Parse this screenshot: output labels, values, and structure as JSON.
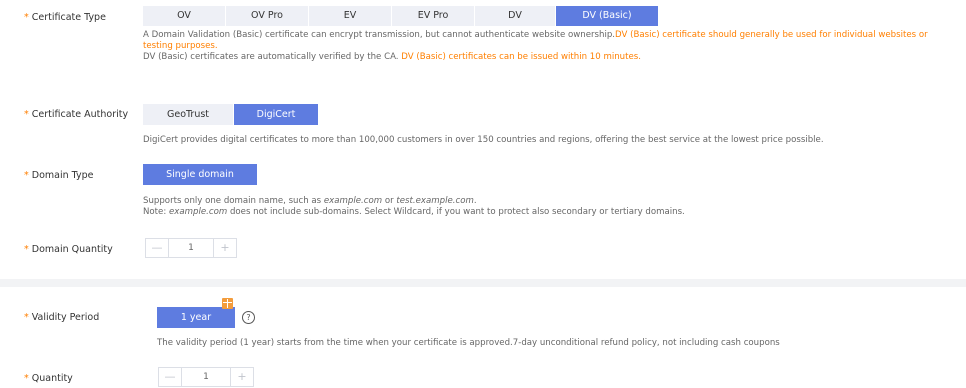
{
  "certificate_type": {
    "label": "Certificate Type",
    "options": [
      "OV",
      "OV Pro",
      "EV",
      "EV Pro",
      "DV",
      "DV (Basic)"
    ],
    "selected": "DV (Basic)",
    "desc_line1_a": "A Domain Validation (Basic) certificate can encrypt transmission, but cannot authenticate website ownership.",
    "desc_line1_b": "DV (Basic) certificate should generally be used for individual websites or",
    "desc_line2": "testing purposes.",
    "desc_line3_a": "DV (Basic) certificates are automatically verified by the CA. ",
    "desc_line3_b": "DV (Basic) certificates can be issued within 10 minutes."
  },
  "certificate_authority": {
    "label": "Certificate Authority",
    "options": [
      "GeoTrust",
      "DigiCert"
    ],
    "selected": "DigiCert",
    "desc": "DigiCert provides digital certificates to more than 100,000 customers in over 150 countries and regions, offering the best service at the lowest price possible."
  },
  "domain_type": {
    "label": "Domain Type",
    "button": "Single domain",
    "desc1_a": "Supports only one domain name, such as ",
    "desc1_ex1": "example.com",
    "desc1_b": " or ",
    "desc1_ex2": "test.example.com",
    "desc1_c": ".",
    "desc2_a": "Note: ",
    "desc2_ex": "example.com",
    "desc2_b": " does not include sub-domains. Select Wildcard, if you want to protect also secondary or tertiary domains."
  },
  "domain_quantity": {
    "label": "Domain Quantity",
    "minus": "—",
    "value": "1",
    "plus": "+"
  },
  "validity_period": {
    "label": "Validity Period",
    "button": "1 year",
    "help": "?",
    "desc": "The validity period (1 year) starts from the time when your certificate is approved.7-day unconditional refund policy, not including cash coupons"
  },
  "quantity": {
    "label": "Quantity",
    "minus": "—",
    "value": "1",
    "plus": "+"
  },
  "colors": {
    "accent": "#5e7ce0",
    "required_star": "#ff7f00",
    "warning_text": "#ff7f00"
  },
  "icons": [
    "required-star",
    "help-circle-icon",
    "gift-icon"
  ]
}
